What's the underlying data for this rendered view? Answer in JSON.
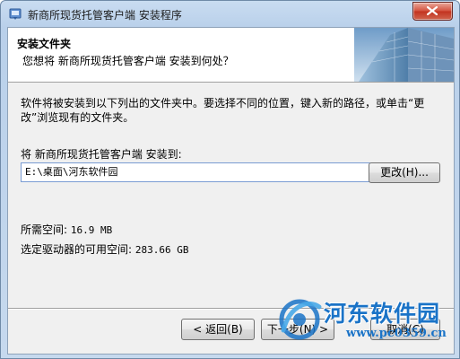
{
  "window": {
    "title": "新商所现货托管客户端 安装程序",
    "close_icon": "close-icon"
  },
  "header": {
    "title": "安装文件夹",
    "subtitle": "您想将 新商所现货托管客户端 安装到何处？"
  },
  "body": {
    "description": "软件将被安装到以下列出的文件夹中。要选择不同的位置，键入新的路径，或单击“更改”浏览现有的文件夹。",
    "install_label": "将 新商所现货托管客户端 安装到:",
    "install_path": "E:\\桌面\\河东软件园",
    "browse_label": "更改(H)...",
    "space_required_label": "所需空间: ",
    "space_required_value": "16.9 MB",
    "space_available_label": "选定驱动器的可用空间: ",
    "space_available_value": "283.66 GB"
  },
  "footer": {
    "back_label": "< 返回(B)",
    "next_label": "下一步(N) >",
    "cancel_label": "取消(C)"
  },
  "watermark": {
    "title": "河东软件园",
    "url": "www.pc0359.cn"
  },
  "colors": {
    "titlebar": "#c9dcf1",
    "close_button": "#c2321f",
    "watermark": "#1a73c7"
  }
}
